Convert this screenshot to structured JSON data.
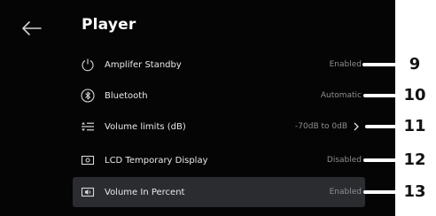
{
  "page": {
    "title": "Player"
  },
  "rows": [
    {
      "label": "Amplifer Standby",
      "value": "Enabled",
      "icon": "power-icon"
    },
    {
      "label": "Bluetooth",
      "value": "Automatic",
      "icon": "bluetooth-icon"
    },
    {
      "label": "Volume limits (dB)",
      "value": "-70dB to 0dB",
      "icon": "volume-limits-icon"
    },
    {
      "label": "LCD Temporary Display",
      "value": "Disabled",
      "icon": "lcd-display-icon"
    },
    {
      "label": "Volume In Percent",
      "value": "Enabled",
      "icon": "volume-percent-icon"
    }
  ],
  "callouts": [
    "9",
    "10",
    "11",
    "12",
    "13"
  ],
  "colors": {
    "background": "#050505",
    "selected_row": "#2a2c30",
    "value_text": "#8e8e8e",
    "callout": "#ffffff"
  }
}
